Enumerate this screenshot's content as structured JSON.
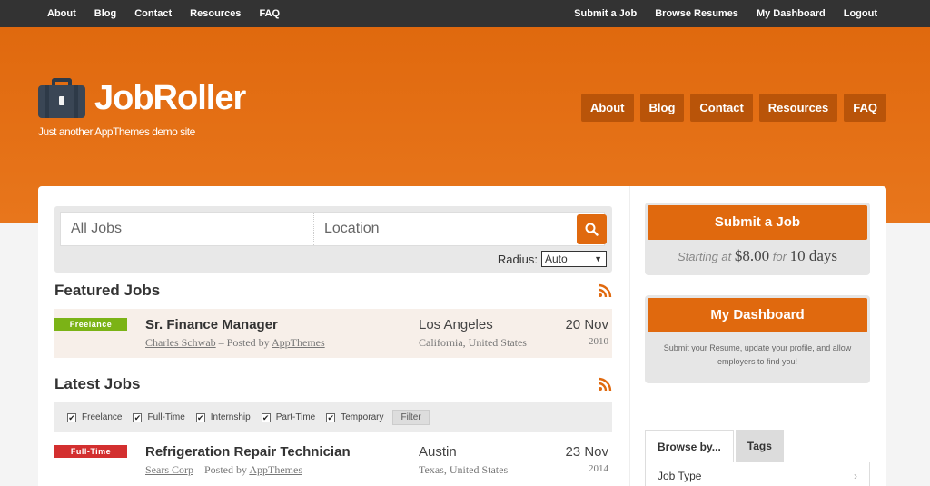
{
  "topbar": {
    "left": [
      "About",
      "Blog",
      "Contact",
      "Resources",
      "FAQ"
    ],
    "right": [
      "Submit a Job",
      "Browse Resumes",
      "My Dashboard",
      "Logout"
    ]
  },
  "brand": {
    "name": "JobRoller",
    "tagline": "Just another AppThemes demo site"
  },
  "header_nav": [
    "About",
    "Blog",
    "Contact",
    "Resources",
    "FAQ"
  ],
  "search": {
    "keyword_placeholder": "All Jobs",
    "location_placeholder": "Location",
    "radius_label": "Radius:",
    "radius_value": "Auto"
  },
  "featured": {
    "title": "Featured Jobs",
    "jobs": [
      {
        "badge": "Freelance",
        "title": "Sr. Finance Manager",
        "company": "Charles Schwab",
        "posted_prefix": " – Posted by ",
        "poster": "AppThemes",
        "city": "Los Angeles",
        "region": "California, United States",
        "date": "20 Nov",
        "year": "2010"
      }
    ]
  },
  "latest": {
    "title": "Latest Jobs",
    "filters": [
      "Freelance",
      "Full-Time",
      "Internship",
      "Part-Time",
      "Temporary"
    ],
    "filter_button": "Filter",
    "jobs": [
      {
        "badge": "Full-Time",
        "title": "Refrigeration Repair Technician",
        "company": "Sears Corp",
        "posted_prefix": " – Posted by ",
        "poster": "AppThemes",
        "city": "Austin",
        "region": "Texas, United States",
        "date": "23 Nov",
        "year": "2014"
      }
    ]
  },
  "sidebar": {
    "submit": {
      "label": "Submit a Job",
      "price_prefix": "Starting at",
      "price": "$8.00",
      "for": "for",
      "duration": "10 days"
    },
    "dashboard": {
      "label": "My Dashboard",
      "text": "Submit your Resume, update your profile, and allow employers to find you!"
    },
    "tabs": [
      "Browse by...",
      "Tags"
    ],
    "browse_item": "Job Type"
  },
  "colors": {
    "accent": "#e0690e",
    "dark": "#333333",
    "freelance": "#7bb316",
    "fulltime": "#d32f2f"
  }
}
